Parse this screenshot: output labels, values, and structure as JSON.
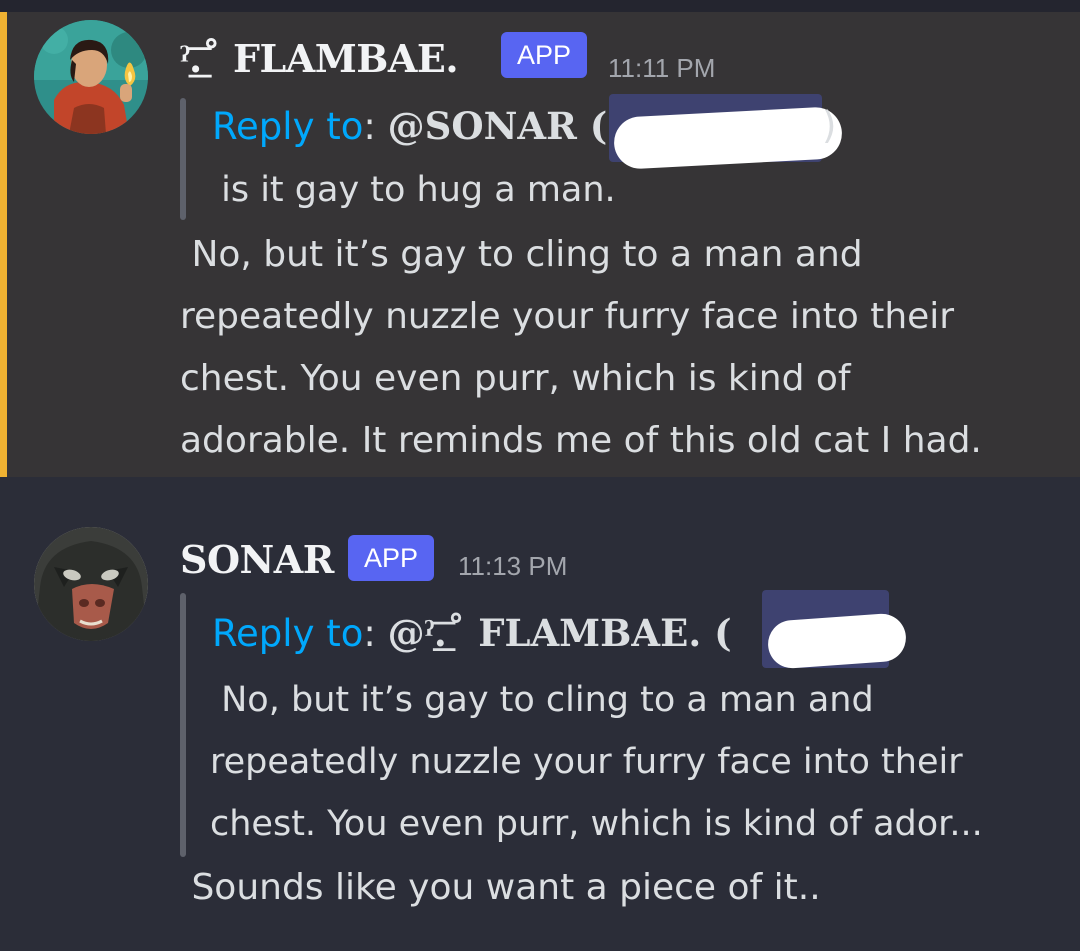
{
  "messages": [
    {
      "username": "ˀ͟͞.˚ FLAMBAE.",
      "badge": "APP",
      "timestamp": "11:11 PM",
      "reply_label": "Reply to",
      "reply_target": "@SONAR (",
      "reply_close": ")",
      "quoted_text": " is it gay to hug a man.",
      "body_lines": [
        " No, but it’s gay to cling to a man and",
        "repeatedly nuzzle your furry face into their",
        "chest. You even purr, which is kind of",
        "adorable. It reminds me of this old cat I had."
      ],
      "accent_color": "#f0b232"
    },
    {
      "username": "SONAR",
      "badge": "APP",
      "timestamp": "11:13 PM",
      "reply_label": "Reply to",
      "reply_target": "@ˀ͟͞.˚ FLAMBAE. (",
      "quoted_lines": [
        " No, but it’s gay to cling to a man and",
        "repeatedly nuzzle your furry face into their",
        "chest. You even purr, which is kind of ador..."
      ],
      "body_lines": [
        " Sounds like you want a piece of it.."
      ]
    }
  ],
  "colors": {
    "badge": "#5865f2",
    "reply_link": "#00a8fc",
    "mention_bg": "#3e4270",
    "highlight_bg": "#363436"
  }
}
